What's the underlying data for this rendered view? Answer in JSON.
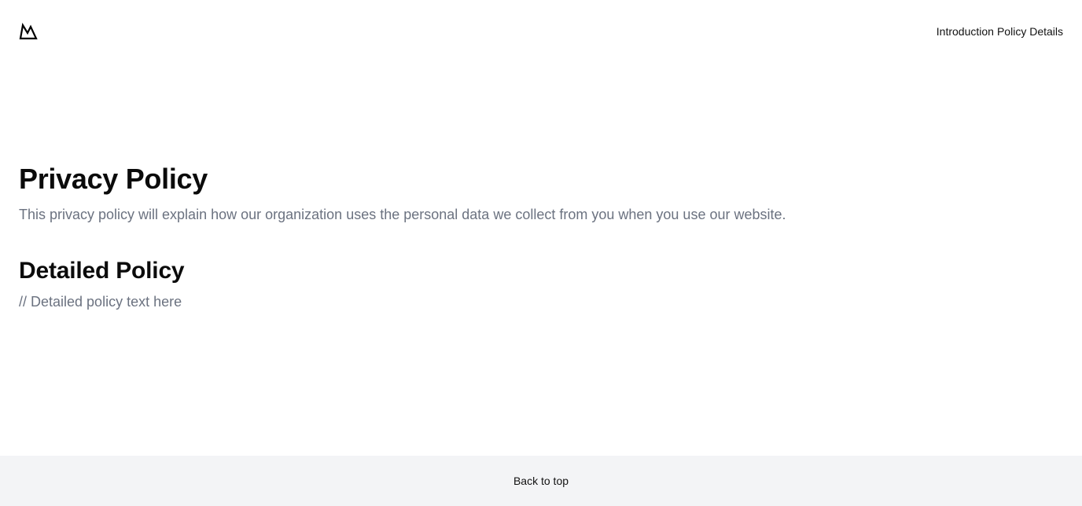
{
  "header": {
    "logo_icon": "mountain-logo-icon",
    "nav": [
      {
        "label": "Introduction"
      },
      {
        "label": "Policy Details"
      }
    ]
  },
  "main": {
    "title": "Privacy Policy",
    "lead": "This privacy policy will explain how our organization uses the personal data we collect from you when you use our website.",
    "section_title": "Detailed Policy",
    "section_text": "// Detailed policy text here"
  },
  "footer": {
    "back_to_top": "Back to top"
  },
  "colors": {
    "heading": "#0b0b0b",
    "muted_text": "#6b7280",
    "footer_bg": "#f3f4f6"
  }
}
